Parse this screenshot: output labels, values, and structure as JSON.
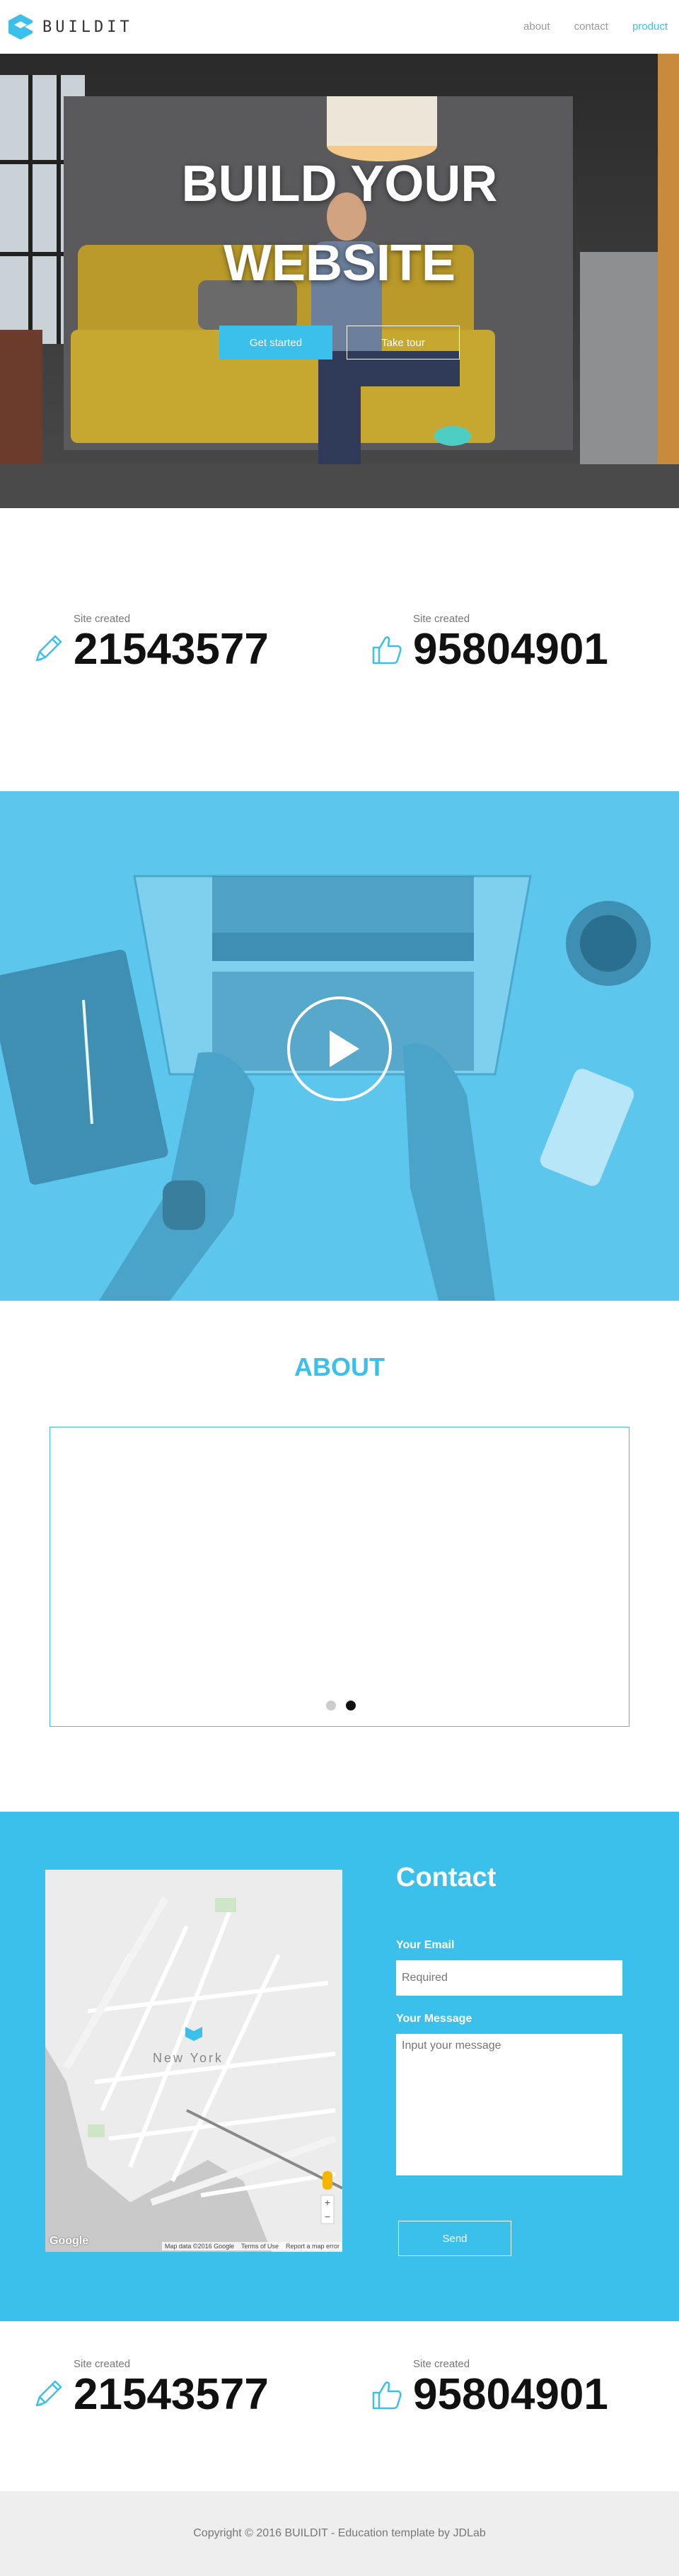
{
  "header": {
    "logo_text": "BUILDIT",
    "nav": [
      {
        "label": "about"
      },
      {
        "label": "contact"
      },
      {
        "label": "product"
      }
    ]
  },
  "hero": {
    "title_line1": "BUILD YOUR",
    "title_line2": "WEBSITE",
    "primary_button": "Get started",
    "secondary_button": "Take tour"
  },
  "stats": [
    {
      "label": "Site created",
      "value": "21543577",
      "icon": "pencil-icon"
    },
    {
      "label": "Site created",
      "value": "95804901",
      "icon": "thumbs-up-icon"
    }
  ],
  "about": {
    "title": "ABOUT"
  },
  "contact": {
    "title": "Contact",
    "email_label": "Your Email",
    "email_placeholder": "Required",
    "message_label": "Your Message",
    "message_placeholder": "Input your message",
    "send_button": "Send",
    "map_labels": {
      "city": "New York",
      "google": "Google",
      "attribution": "Map data ©2016 Google    Terms of Use    Report a map error"
    }
  },
  "footer": {
    "copyright": "Copyright © 2016 BUILDIT - Education template by JDLab"
  },
  "colors": {
    "accent": "#3bbfeb"
  }
}
